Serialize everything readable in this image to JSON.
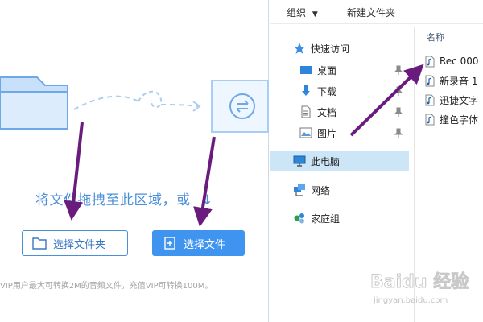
{
  "converter": {
    "drop_hint": "将文件拖拽至此区域，或",
    "drop_arrow": "↓",
    "select_folder_label": "选择文件夹",
    "select_file_label": "选择文件",
    "notice": "VIP用户最大可转换2M的音频文件，充值VIP可转换100M。",
    "accent_color": "#3e94ef"
  },
  "explorer": {
    "toolbar": {
      "organize_label": "组织",
      "organize_caret": "▼",
      "new_folder_label": "新建文件夹"
    },
    "nav": {
      "quick_access": {
        "label": "快速访问",
        "icon": "star-icon"
      },
      "pinned": [
        {
          "label": "桌面",
          "icon": "desktop-icon"
        },
        {
          "label": "下载",
          "icon": "download-icon"
        },
        {
          "label": "文档",
          "icon": "document-icon"
        },
        {
          "label": "图片",
          "icon": "picture-icon"
        }
      ],
      "this_pc": {
        "label": "此电脑",
        "icon": "computer-icon",
        "selected": true
      },
      "network": {
        "label": "网络",
        "icon": "network-icon"
      },
      "homegroup": {
        "label": "家庭组",
        "icon": "homegroup-icon"
      }
    },
    "files": {
      "column_header": "名称",
      "items": [
        {
          "name": "Rec 000",
          "icon": "audio-file-icon"
        },
        {
          "name": "新录音 1",
          "icon": "audio-file-icon"
        },
        {
          "name": "迅捷文字",
          "icon": "audio-file-icon"
        },
        {
          "name": "撞色字体",
          "icon": "audio-file-icon"
        }
      ]
    }
  },
  "watermark": {
    "brand": "Baidu 经验",
    "url": "jingyan.baidu.com"
  }
}
